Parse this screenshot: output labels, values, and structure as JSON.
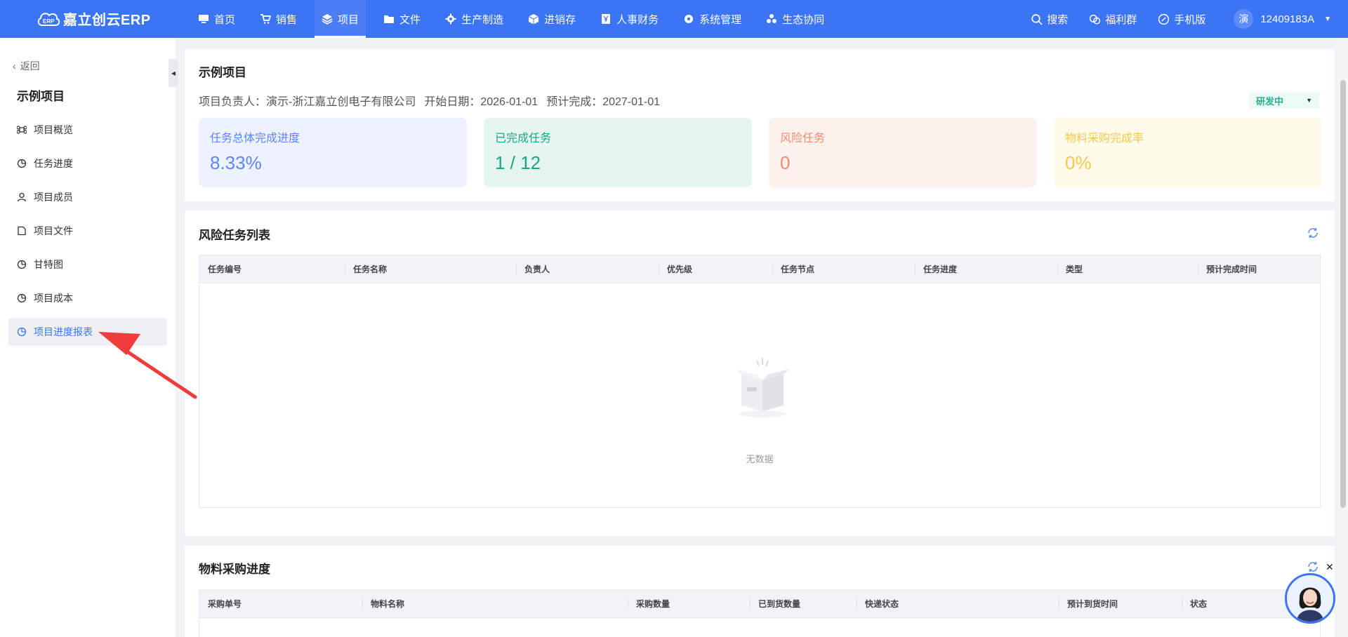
{
  "app": {
    "logo_text": "嘉立创云ERP",
    "logo_badge": "ERP"
  },
  "nav": [
    {
      "label": "首页",
      "icon": "monitor-icon"
    },
    {
      "label": "销售",
      "icon": "cart-icon"
    },
    {
      "label": "项目",
      "icon": "layers-icon",
      "active": true
    },
    {
      "label": "文件",
      "icon": "folder-icon"
    },
    {
      "label": "生产制造",
      "icon": "cog-icon"
    },
    {
      "label": "进销存",
      "icon": "box-icon"
    },
    {
      "label": "人事财务",
      "icon": "yen-icon"
    },
    {
      "label": "系统管理",
      "icon": "gear-icon"
    },
    {
      "label": "生态协同",
      "icon": "cluster-icon"
    }
  ],
  "tools": {
    "search": "搜索",
    "welfare": "福利群",
    "mobile": "手机版"
  },
  "user": {
    "avatar_char": "演",
    "name": "12409183A"
  },
  "sidebar": {
    "back": "返回",
    "title": "示例项目",
    "items": [
      {
        "label": "项目概览"
      },
      {
        "label": "任务进度"
      },
      {
        "label": "项目成员"
      },
      {
        "label": "项目文件"
      },
      {
        "label": "甘特图"
      },
      {
        "label": "项目成本"
      },
      {
        "label": "项目进度报表",
        "active": true
      }
    ]
  },
  "project": {
    "title": "示例项目",
    "owner": "项目负责人：演示-浙江嘉立创电子有限公司",
    "start": "开始日期：2026-01-01",
    "due": "预计完成：2027-01-01",
    "status": "研发中"
  },
  "stats": [
    {
      "label": "任务总体完成进度",
      "value": "8.33%"
    },
    {
      "label": "已完成任务",
      "value": "1 / 12"
    },
    {
      "label": "风险任务",
      "value": "0"
    },
    {
      "label": "物料采购完成率",
      "value": "0%"
    }
  ],
  "risk_table": {
    "title": "风险任务列表",
    "columns": [
      "任务编号",
      "任务名称",
      "负责人",
      "优先级",
      "任务节点",
      "任务进度",
      "类型",
      "预计完成时间"
    ],
    "empty_text": "无数据"
  },
  "purchase_table": {
    "title": "物料采购进度",
    "columns": [
      "采购单号",
      "物料名称",
      "采购数量",
      "已到货数量",
      "快递状态",
      "预计到货时间",
      "状态"
    ]
  },
  "colors": {
    "primary": "#3c74f6",
    "annotation_arrow": "#f03c3c"
  }
}
